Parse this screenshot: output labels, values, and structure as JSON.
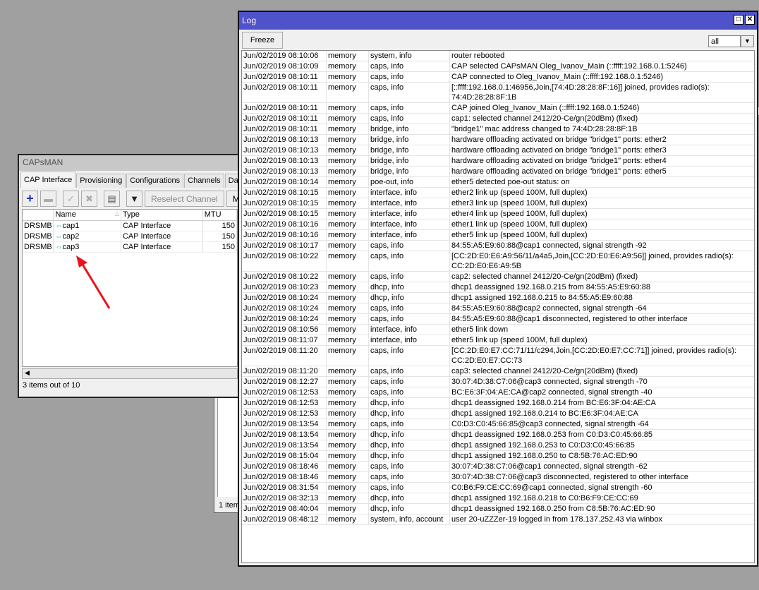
{
  "background_windows": {
    "status_text": "1 item"
  },
  "capsman": {
    "title": "CAPsMAN",
    "tabs": [
      "CAP Interface",
      "Provisioning",
      "Configurations",
      "Channels",
      "Data"
    ],
    "toolbar": {
      "add_icon": "plus-icon",
      "remove_icon": "minus-icon",
      "enable_icon": "check-icon",
      "disable_icon": "x-icon",
      "comment_icon": "comment-icon",
      "filter_icon": "filter-icon",
      "reselect_label": "Reselect Channel",
      "more_label": "Ma"
    },
    "columns": [
      "",
      "Name",
      "Type",
      "MTU"
    ],
    "rows": [
      {
        "flags": "DRSMB",
        "name": "cap1",
        "type": "CAP Interface",
        "mtu": "150"
      },
      {
        "flags": "DRSMB",
        "name": "cap2",
        "type": "CAP Interface",
        "mtu": "150"
      },
      {
        "flags": "DRSMB",
        "name": "cap3",
        "type": "CAP Interface",
        "mtu": "150"
      }
    ],
    "status": "3 items out of 10",
    "accent": "#ff0000"
  },
  "log": {
    "title": "Log",
    "freeze_label": "Freeze",
    "filter_value": "all",
    "title_color": "#4f52c8",
    "entries": [
      {
        "t": "Jun/02/2019 08:10:06",
        "b": "memory",
        "tp": "system, info",
        "m": "router rebooted"
      },
      {
        "t": "Jun/02/2019 08:10:09",
        "b": "memory",
        "tp": "caps, info",
        "m": "CAP selected CAPsMAN Oleg_Ivanov_Main (::ffff:192.168.0.1:5246)"
      },
      {
        "t": "Jun/02/2019 08:10:11",
        "b": "memory",
        "tp": "caps, info",
        "m": "CAP connected to Oleg_Ivanov_Main (::ffff:192.168.0.1:5246)"
      },
      {
        "t": "Jun/02/2019 08:10:11",
        "b": "memory",
        "tp": "caps, info",
        "m": "[::ffff:192.168.0.1:46956,Join,[74:4D:28:28:8F:16]] joined, provides radio(s):",
        "m2": "74:4D:28:28:8F:1B"
      },
      {
        "t": "Jun/02/2019 08:10:11",
        "b": "memory",
        "tp": "caps, info",
        "m": "CAP joined Oleg_Ivanov_Main (::ffff:192.168.0.1:5246)"
      },
      {
        "t": "Jun/02/2019 08:10:11",
        "b": "memory",
        "tp": "caps, info",
        "m": "cap1: selected channel 2412/20-Ce/gn(20dBm) (fixed)"
      },
      {
        "t": "Jun/02/2019 08:10:11",
        "b": "memory",
        "tp": "bridge, info",
        "m": "\"bridge1\" mac address changed to 74:4D:28:28:8F:1B"
      },
      {
        "t": "Jun/02/2019 08:10:13",
        "b": "memory",
        "tp": "bridge, info",
        "m": "hardware offloading activated on bridge \"bridge1\" ports: ether2"
      },
      {
        "t": "Jun/02/2019 08:10:13",
        "b": "memory",
        "tp": "bridge, info",
        "m": "hardware offloading activated on bridge \"bridge1\" ports: ether3"
      },
      {
        "t": "Jun/02/2019 08:10:13",
        "b": "memory",
        "tp": "bridge, info",
        "m": "hardware offloading activated on bridge \"bridge1\" ports: ether4"
      },
      {
        "t": "Jun/02/2019 08:10:13",
        "b": "memory",
        "tp": "bridge, info",
        "m": "hardware offloading activated on bridge \"bridge1\" ports: ether5"
      },
      {
        "t": "Jun/02/2019 08:10:14",
        "b": "memory",
        "tp": "poe-out, info",
        "m": "ether5 detected poe-out status: on"
      },
      {
        "t": "Jun/02/2019 08:10:15",
        "b": "memory",
        "tp": "interface, info",
        "m": "ether2 link up (speed 100M, full duplex)"
      },
      {
        "t": "Jun/02/2019 08:10:15",
        "b": "memory",
        "tp": "interface, info",
        "m": "ether3 link up (speed 100M, full duplex)"
      },
      {
        "t": "Jun/02/2019 08:10:15",
        "b": "memory",
        "tp": "interface, info",
        "m": "ether4 link up (speed 100M, full duplex)"
      },
      {
        "t": "Jun/02/2019 08:10:16",
        "b": "memory",
        "tp": "interface, info",
        "m": "ether1 link up (speed 100M, full duplex)"
      },
      {
        "t": "Jun/02/2019 08:10:16",
        "b": "memory",
        "tp": "interface, info",
        "m": "ether5 link up (speed 100M, full duplex)"
      },
      {
        "t": "Jun/02/2019 08:10:17",
        "b": "memory",
        "tp": "caps, info",
        "m": "84:55:A5:E9:60:88@cap1 connected, signal strength -92"
      },
      {
        "t": "Jun/02/2019 08:10:22",
        "b": "memory",
        "tp": "caps, info",
        "m": "[CC:2D:E0:E6:A9:56/11/a4a5,Join,[CC:2D:E0:E6:A9:56]] joined, provides radio(s):",
        "m2": "CC:2D:E0:E6:A9:5B"
      },
      {
        "t": "Jun/02/2019 08:10:22",
        "b": "memory",
        "tp": "caps, info",
        "m": "cap2: selected channel 2412/20-Ce/gn(20dBm) (fixed)"
      },
      {
        "t": "Jun/02/2019 08:10:23",
        "b": "memory",
        "tp": "dhcp, info",
        "m": "dhcp1 deassigned 192.168.0.215 from 84:55:A5:E9:60:88"
      },
      {
        "t": "Jun/02/2019 08:10:24",
        "b": "memory",
        "tp": "dhcp, info",
        "m": "dhcp1 assigned 192.168.0.215 to 84:55:A5:E9:60:88"
      },
      {
        "t": "Jun/02/2019 08:10:24",
        "b": "memory",
        "tp": "caps, info",
        "m": "84:55:A5:E9:60:88@cap2 connected, signal strength -64"
      },
      {
        "t": "Jun/02/2019 08:10:24",
        "b": "memory",
        "tp": "caps, info",
        "m": "84:55:A5:E9:60:88@cap1 disconnected, registered to other interface"
      },
      {
        "t": "Jun/02/2019 08:10:56",
        "b": "memory",
        "tp": "interface, info",
        "m": "ether5 link down"
      },
      {
        "t": "Jun/02/2019 08:11:07",
        "b": "memory",
        "tp": "interface, info",
        "m": "ether5 link up (speed 100M, full duplex)"
      },
      {
        "t": "Jun/02/2019 08:11:20",
        "b": "memory",
        "tp": "caps, info",
        "m": "[CC:2D:E0:E7:CC:71/11/c294,Join,[CC:2D:E0:E7:CC:71]] joined, provides radio(s):",
        "m2": "CC:2D:E0:E7:CC:73"
      },
      {
        "t": "Jun/02/2019 08:11:20",
        "b": "memory",
        "tp": "caps, info",
        "m": "cap3: selected channel 2412/20-Ce/gn(20dBm) (fixed)"
      },
      {
        "t": "Jun/02/2019 08:12:27",
        "b": "memory",
        "tp": "caps, info",
        "m": "30:07:4D:38:C7:06@cap3 connected, signal strength -70"
      },
      {
        "t": "Jun/02/2019 08:12:53",
        "b": "memory",
        "tp": "caps, info",
        "m": "BC:E6:3F:04:AE:CA@cap2 connected, signal strength -40"
      },
      {
        "t": "Jun/02/2019 08:12:53",
        "b": "memory",
        "tp": "dhcp, info",
        "m": "dhcp1 deassigned 192.168.0.214 from BC:E6:3F:04:AE:CA"
      },
      {
        "t": "Jun/02/2019 08:12:53",
        "b": "memory",
        "tp": "dhcp, info",
        "m": "dhcp1 assigned 192.168.0.214 to BC:E6:3F:04:AE:CA"
      },
      {
        "t": "Jun/02/2019 08:13:54",
        "b": "memory",
        "tp": "caps, info",
        "m": "C0:D3:C0:45:66:85@cap3 connected, signal strength -64"
      },
      {
        "t": "Jun/02/2019 08:13:54",
        "b": "memory",
        "tp": "dhcp, info",
        "m": "dhcp1 deassigned 192.168.0.253 from C0:D3:C0:45:66:85"
      },
      {
        "t": "Jun/02/2019 08:13:54",
        "b": "memory",
        "tp": "dhcp, info",
        "m": "dhcp1 assigned 192.168.0.253 to C0:D3:C0:45:66:85"
      },
      {
        "t": "Jun/02/2019 08:15:04",
        "b": "memory",
        "tp": "dhcp, info",
        "m": "dhcp1 assigned 192.168.0.250 to C8:5B:76:AC:ED:90"
      },
      {
        "t": "Jun/02/2019 08:18:46",
        "b": "memory",
        "tp": "caps, info",
        "m": "30:07:4D:38:C7:06@cap1 connected, signal strength -62"
      },
      {
        "t": "Jun/02/2019 08:18:46",
        "b": "memory",
        "tp": "caps, info",
        "m": "30:07:4D:38:C7:06@cap3 disconnected, registered to other interface"
      },
      {
        "t": "Jun/02/2019 08:31:54",
        "b": "memory",
        "tp": "caps, info",
        "m": "C0:B6:F9:CE:CC:69@cap1 connected, signal strength -60"
      },
      {
        "t": "Jun/02/2019 08:32:13",
        "b": "memory",
        "tp": "dhcp, info",
        "m": "dhcp1 assigned 192.168.0.218 to C0:B6:F9:CE:CC:69"
      },
      {
        "t": "Jun/02/2019 08:40:04",
        "b": "memory",
        "tp": "dhcp, info",
        "m": "dhcp1 deassigned 192.168.0.250 from C8:5B:76:AC:ED:90"
      },
      {
        "t": "Jun/02/2019 08:48:12",
        "b": "memory",
        "tp": "system, info, account",
        "m": "user 20-uZZZer-19 logged in from 178.137.252.43 via winbox"
      }
    ]
  }
}
